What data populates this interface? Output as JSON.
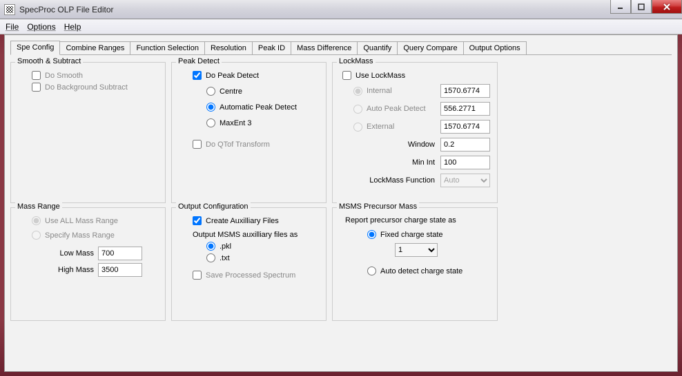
{
  "window": {
    "title": "SpecProc OLP File Editor"
  },
  "menu": {
    "file": "File",
    "options": "Options",
    "help": "Help"
  },
  "tabs": [
    "Spe Config",
    "Combine Ranges",
    "Function Selection",
    "Resolution",
    "Peak ID",
    "Mass Difference",
    "Quantify",
    "Query Compare",
    "Output Options"
  ],
  "groups": {
    "smooth": {
      "title": "Smooth & Subtract",
      "do_smooth": "Do Smooth",
      "do_bg": "Do Background Subtract"
    },
    "peakdetect": {
      "title": "Peak Detect",
      "do_peak": "Do Peak Detect",
      "centre": "Centre",
      "auto": "Automatic Peak Detect",
      "maxent": "MaxEnt 3",
      "qtof": "Do QTof Transform"
    },
    "lockmass": {
      "title": "LockMass",
      "use": "Use LockMass",
      "internal": "Internal",
      "auto": "Auto Peak Detect",
      "external": "External",
      "window": "Window",
      "minint": "Min Int",
      "func": "LockMass Function",
      "val_internal": "1570.6774",
      "val_auto": "556.2771",
      "val_external": "1570.6774",
      "val_window": "0.2",
      "val_minint": "100",
      "val_func": "Auto"
    },
    "massrange": {
      "title": "Mass Range",
      "useall": "Use ALL Mass Range",
      "specify": "Specify Mass Range",
      "low": "Low Mass",
      "high": "High Mass",
      "val_low": "700",
      "val_high": "3500"
    },
    "outputcfg": {
      "title": "Output Configuration",
      "create": "Create Auxilliary Files",
      "outputas": "Output MSMS auxilliary files as",
      "pkl": ".pkl",
      "txt": ".txt",
      "save": "Save Processed Spectrum"
    },
    "msms": {
      "title": "MSMS Precursor Mass",
      "report": "Report precursor charge state as",
      "fixed": "Fixed charge state",
      "val_fixed": "1",
      "auto": "Auto detect charge state"
    }
  }
}
